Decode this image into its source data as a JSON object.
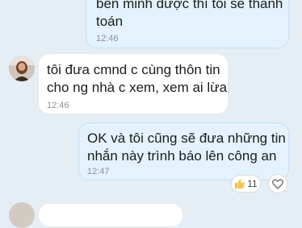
{
  "conversation": {
    "messages": [
      {
        "direction": "outgoing",
        "text": "bên minh được thì tôi sẽ thanh\ntoán",
        "time": "12:46"
      },
      {
        "direction": "incoming",
        "text": "tôi đưa cmnd c cùng thôn tin\ncho ng nhà c xem, xem ai lừa",
        "time": "12:46"
      },
      {
        "direction": "outgoing",
        "text": "OK và tôi cũng sẽ đưa những tin\nnhắn này trình báo lên công an",
        "time": "12:47"
      }
    ],
    "reaction": {
      "icon": "thumbs-up-icon",
      "count": "11"
    },
    "react_add_icon": "heart-outline-icon"
  },
  "colors": {
    "background": "#e5edf5",
    "outgoing_bubble": "#e3f2fd",
    "incoming_bubble": "#ffffff",
    "timestamp": "#8a9099"
  }
}
